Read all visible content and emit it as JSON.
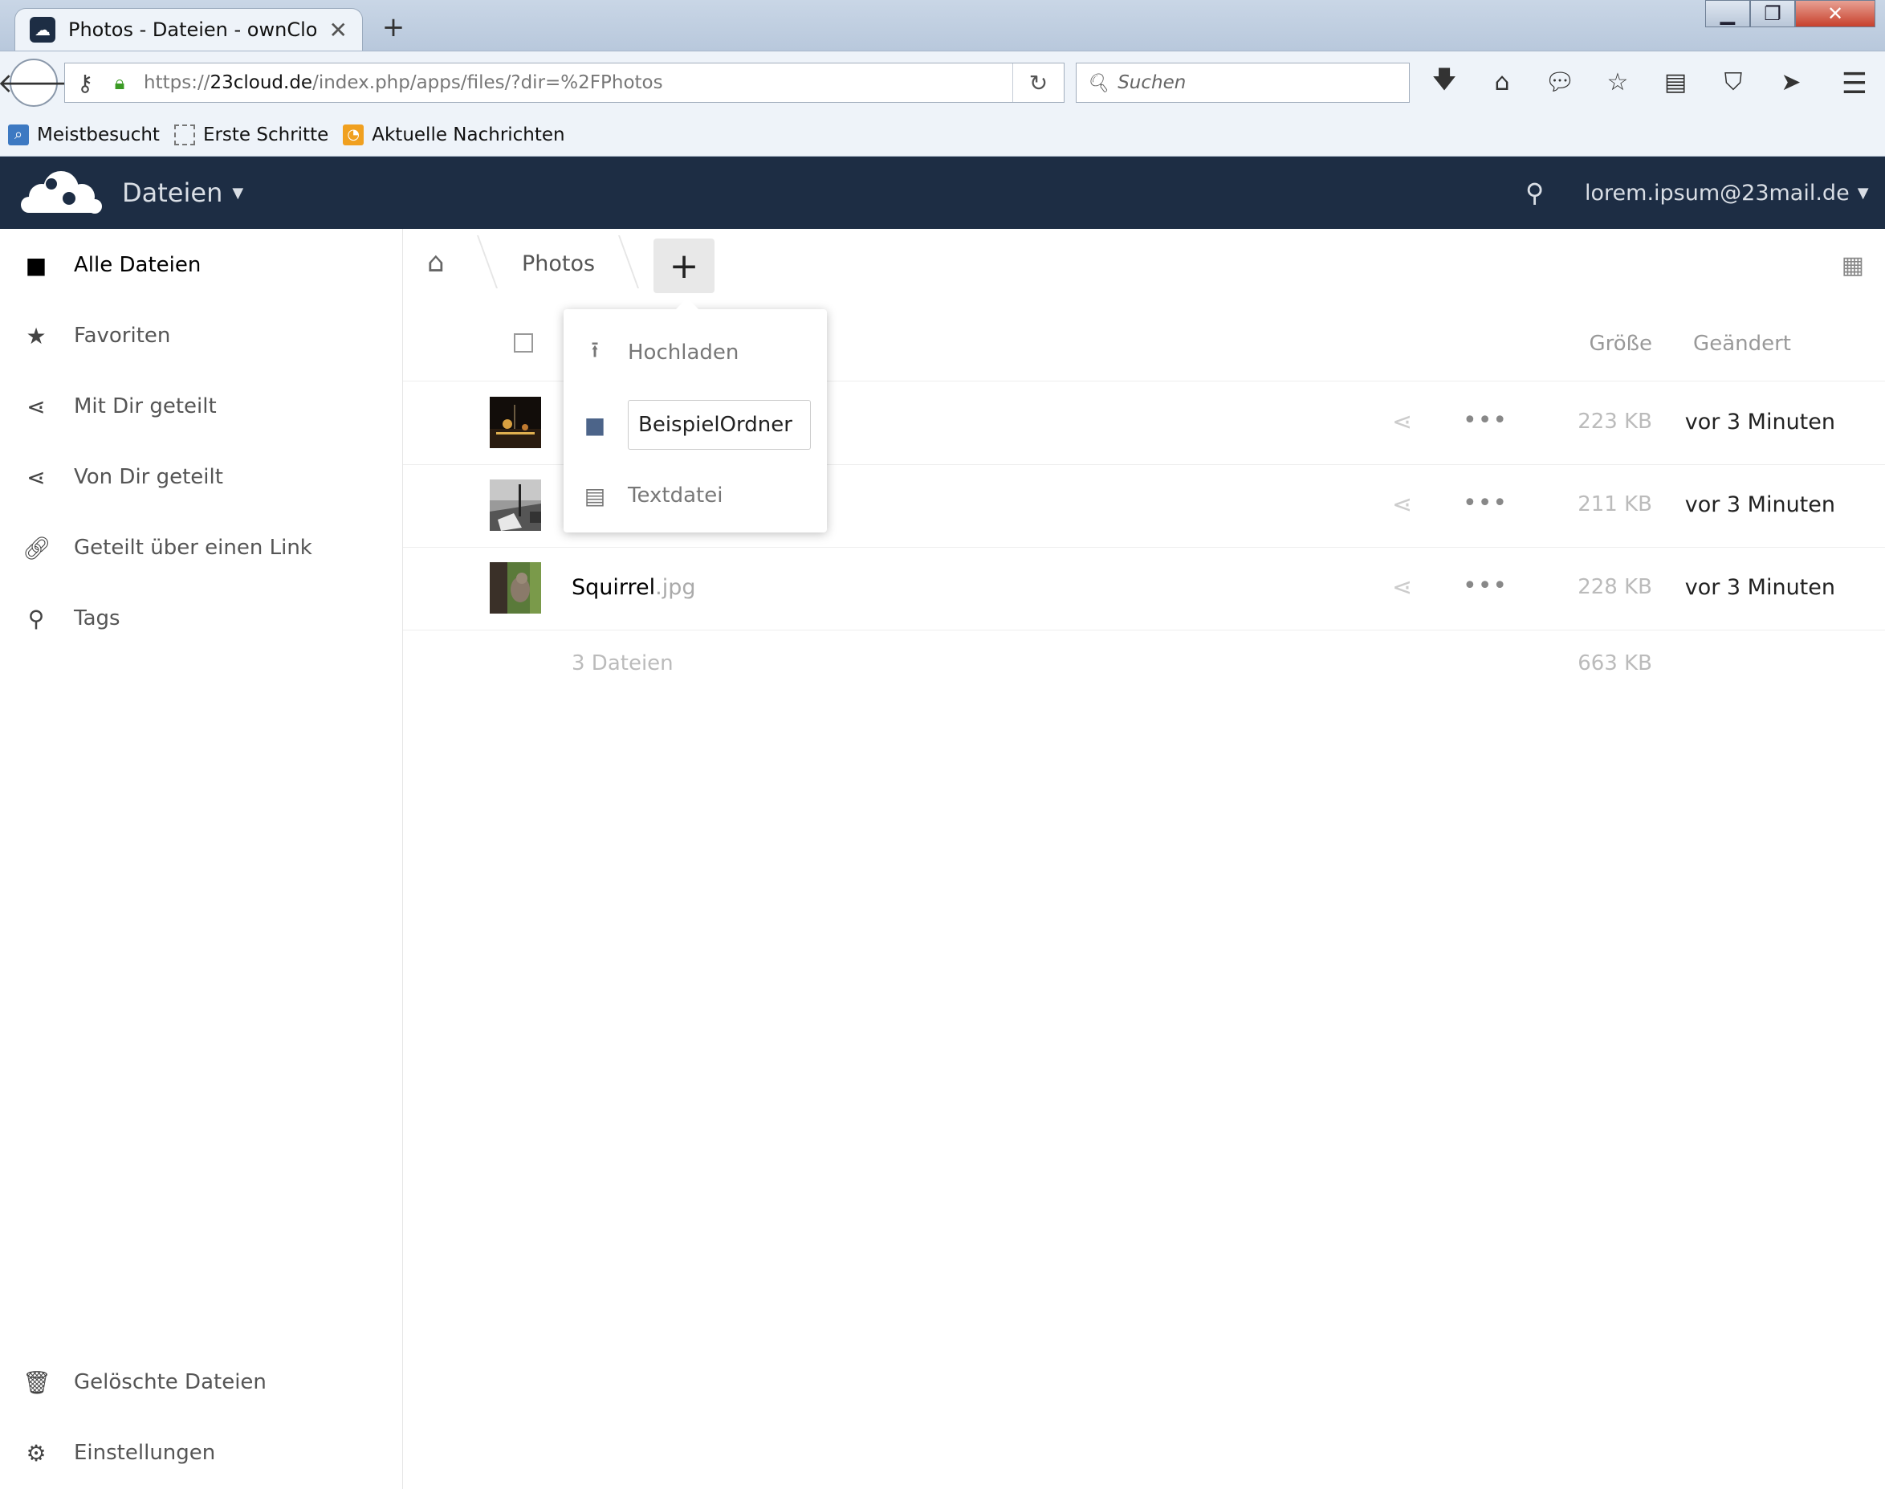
{
  "browser": {
    "tab_title": "Photos - Dateien - ownClo...",
    "close_tab": "✕",
    "new_tab": "+",
    "url_prefix": "https://",
    "url_host": "23cloud.de",
    "url_path": "/index.php/apps/files/?dir=%2FPhotos",
    "search_placeholder": "Suchen",
    "bookmarks": [
      "Meistbesucht",
      "Erste Schritte",
      "Aktuelle Nachrichten"
    ]
  },
  "header": {
    "app_name": "Dateien",
    "user": "lorem.ipsum@23mail.de"
  },
  "sidebar": {
    "items": [
      {
        "label": "Alle Dateien",
        "icon": "folder-icon"
      },
      {
        "label": "Favoriten",
        "icon": "star-icon"
      },
      {
        "label": "Mit Dir geteilt",
        "icon": "share-icon"
      },
      {
        "label": "Von Dir geteilt",
        "icon": "share-icon"
      },
      {
        "label": "Geteilt über einen Link",
        "icon": "link-icon"
      },
      {
        "label": "Tags",
        "icon": "search-icon"
      }
    ],
    "bottom": [
      {
        "label": "Gelöschte Dateien",
        "icon": "trash-icon"
      },
      {
        "label": "Einstellungen",
        "icon": "gear-icon"
      }
    ]
  },
  "breadcrumb": {
    "current": "Photos",
    "new_button": "+"
  },
  "columns": {
    "size": "Größe",
    "modified": "Geändert"
  },
  "files": [
    {
      "name": "",
      "ext": "",
      "size": "223 KB",
      "modified": "vor 3 Minuten"
    },
    {
      "name": "",
      "ext": "",
      "size": "211 KB",
      "modified": "vor 3 Minuten"
    },
    {
      "name": "Squirrel",
      "ext": ".jpg",
      "size": "228 KB",
      "modified": "vor 3 Minuten"
    }
  ],
  "summary": {
    "count": "3 Dateien",
    "size": "663 KB"
  },
  "new_menu": {
    "upload": "Hochladen",
    "folder_value": "BeispielOrdner",
    "textfile": "Textdatei"
  }
}
